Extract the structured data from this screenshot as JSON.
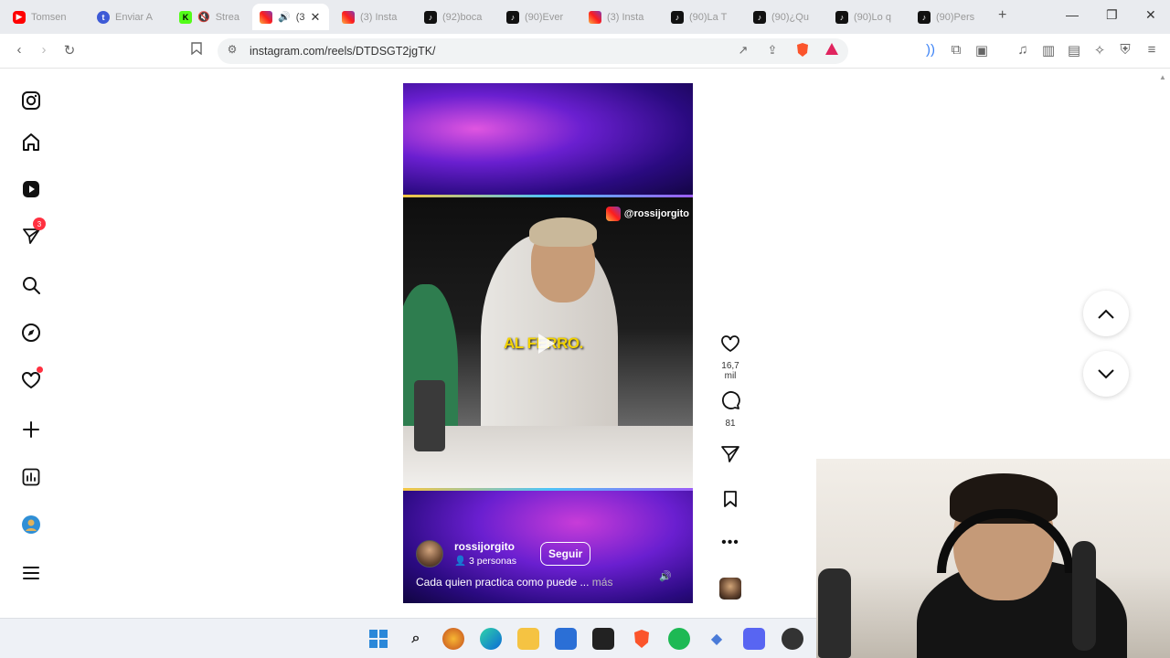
{
  "browser": {
    "tabs": [
      {
        "title": "Tomsen",
        "favicon": "youtube-icon"
      },
      {
        "title": "Enviar A",
        "favicon": "twitch-icon"
      },
      {
        "title": "Strea",
        "favicon": "kick-icon"
      },
      {
        "title": "(3",
        "favicon": "instagram-icon",
        "active": true
      },
      {
        "title": "(3) Insta",
        "favicon": "instagram-icon"
      },
      {
        "title": "(92)boca",
        "favicon": "tiktok-icon"
      },
      {
        "title": "(90)Ever",
        "favicon": "tiktok-icon"
      },
      {
        "title": "(3) Insta",
        "favicon": "instagram-icon"
      },
      {
        "title": "(90)La T",
        "favicon": "tiktok-icon"
      },
      {
        "title": "(90)¿Qu",
        "favicon": "tiktok-icon"
      },
      {
        "title": "(90)Lo q",
        "favicon": "tiktok-icon"
      },
      {
        "title": "(90)Pers",
        "favicon": "tiktok-icon"
      }
    ],
    "url": "instagram.com/reels/DTDSGT2jgTK/",
    "brand_accent": "#fb542b"
  },
  "sidebar": {
    "notifications_badge": "3"
  },
  "reel": {
    "watermark": "@rossijorgito",
    "overlay_caption": "AL FERRO.",
    "username": "rossijorgito",
    "people": "3 personas",
    "follow_label": "Seguir",
    "description": "Cada quien practica como puede ...",
    "more": "más"
  },
  "actions": {
    "likes": "16,7 mil",
    "comments": "81"
  },
  "colors": {
    "reel_purple": "#6a1fd0",
    "notification_red": "#ff3040"
  }
}
